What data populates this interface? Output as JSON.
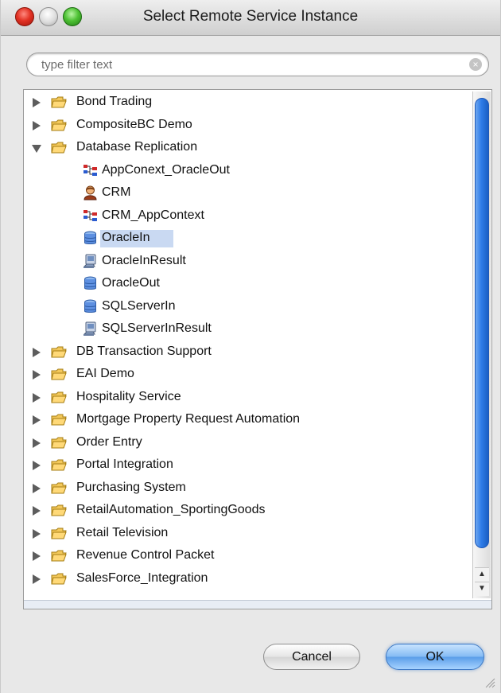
{
  "window": {
    "title": "Select Remote Service Instance",
    "controls": [
      "close",
      "minimize",
      "zoom"
    ]
  },
  "search": {
    "placeholder": "type filter text"
  },
  "tree": {
    "selected": "OracleIn",
    "items": [
      {
        "label": "Bond Trading",
        "type": "folder",
        "expanded": false
      },
      {
        "label": "CompositeBC Demo",
        "type": "folder",
        "expanded": false
      },
      {
        "label": "Database Replication",
        "type": "folder",
        "expanded": true
      },
      {
        "label": "AppConext_OracleOut",
        "type": "child",
        "icon": "app-context-icon"
      },
      {
        "label": "CRM",
        "type": "child",
        "icon": "person-icon"
      },
      {
        "label": "CRM_AppContext",
        "type": "child",
        "icon": "app-context-icon"
      },
      {
        "label": "OracleIn",
        "type": "child",
        "icon": "database-icon"
      },
      {
        "label": "OracleInResult",
        "type": "child",
        "icon": "computer-icon"
      },
      {
        "label": "OracleOut",
        "type": "child",
        "icon": "database-icon"
      },
      {
        "label": "SQLServerIn",
        "type": "child",
        "icon": "database-icon"
      },
      {
        "label": "SQLServerInResult",
        "type": "child",
        "icon": "computer-icon"
      },
      {
        "label": "DB Transaction Support",
        "type": "folder",
        "expanded": false
      },
      {
        "label": "EAI Demo",
        "type": "folder",
        "expanded": false
      },
      {
        "label": "Hospitality Service",
        "type": "folder",
        "expanded": false
      },
      {
        "label": "Mortgage Property Request Automation",
        "type": "folder",
        "expanded": false
      },
      {
        "label": "Order Entry",
        "type": "folder",
        "expanded": false
      },
      {
        "label": "Portal Integration",
        "type": "folder",
        "expanded": false
      },
      {
        "label": "Purchasing System",
        "type": "folder",
        "expanded": false
      },
      {
        "label": "RetailAutomation_SportingGoods",
        "type": "folder",
        "expanded": false
      },
      {
        "label": "Retail Television",
        "type": "folder",
        "expanded": false
      },
      {
        "label": "Revenue Control Packet",
        "type": "folder",
        "expanded": false
      },
      {
        "label": "SalesForce_Integration",
        "type": "folder",
        "expanded": false
      }
    ]
  },
  "buttons": {
    "cancel": "Cancel",
    "ok": "OK"
  },
  "colors": {
    "selection": "#c9d9f2",
    "scroll_thumb": "#2e7ce8",
    "folder": "#f3c85a"
  }
}
